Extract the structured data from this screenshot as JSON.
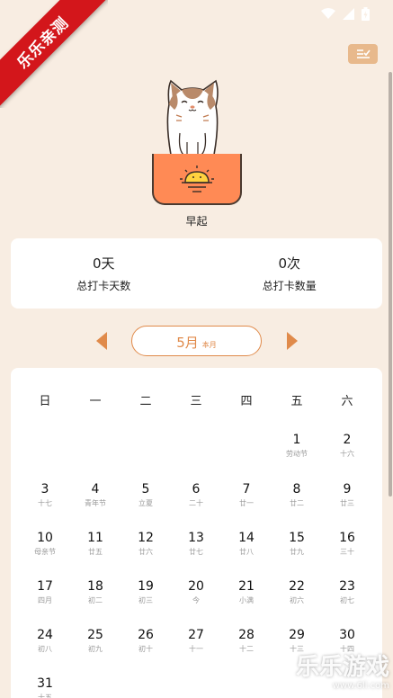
{
  "banner": {
    "text": "乐乐亲测"
  },
  "habit": {
    "name": "早起"
  },
  "stats": [
    {
      "value": "0天",
      "label": "总打卡天数"
    },
    {
      "value": "0次",
      "label": "总打卡数量"
    }
  ],
  "month": {
    "label": "5月",
    "sub": "本月"
  },
  "weekdays": [
    "日",
    "一",
    "二",
    "三",
    "四",
    "五",
    "六"
  ],
  "days": [
    {
      "num": "1",
      "lunar": "劳动节"
    },
    {
      "num": "2",
      "lunar": "十六"
    },
    {
      "num": "3",
      "lunar": "十七"
    },
    {
      "num": "4",
      "lunar": "青年节"
    },
    {
      "num": "5",
      "lunar": "立夏"
    },
    {
      "num": "6",
      "lunar": "二十"
    },
    {
      "num": "7",
      "lunar": "廿一"
    },
    {
      "num": "8",
      "lunar": "廿二"
    },
    {
      "num": "9",
      "lunar": "廿三"
    },
    {
      "num": "10",
      "lunar": "母亲节"
    },
    {
      "num": "11",
      "lunar": "廿五"
    },
    {
      "num": "12",
      "lunar": "廿六"
    },
    {
      "num": "13",
      "lunar": "廿七"
    },
    {
      "num": "14",
      "lunar": "廿八"
    },
    {
      "num": "15",
      "lunar": "廿九"
    },
    {
      "num": "16",
      "lunar": "三十"
    },
    {
      "num": "17",
      "lunar": "四月"
    },
    {
      "num": "18",
      "lunar": "初二"
    },
    {
      "num": "19",
      "lunar": "初三"
    },
    {
      "num": "20",
      "lunar": "今"
    },
    {
      "num": "21",
      "lunar": "小满"
    },
    {
      "num": "22",
      "lunar": "初六"
    },
    {
      "num": "23",
      "lunar": "初七"
    },
    {
      "num": "24",
      "lunar": "初八"
    },
    {
      "num": "25",
      "lunar": "初九"
    },
    {
      "num": "26",
      "lunar": "初十"
    },
    {
      "num": "27",
      "lunar": "十一"
    },
    {
      "num": "28",
      "lunar": "十二"
    },
    {
      "num": "29",
      "lunar": "十三"
    },
    {
      "num": "30",
      "lunar": "十四"
    },
    {
      "num": "31",
      "lunar": "十五"
    }
  ],
  "watermark": {
    "text": "乐乐游戏",
    "url": "www.6ll.com"
  },
  "colors": {
    "background": "#f8ede2",
    "accent": "#e08a4a",
    "pocket": "#ff8a55",
    "banner": "#d3161b"
  },
  "icons": [
    "wifi-icon",
    "signal-icon",
    "battery-icon",
    "checklist-icon",
    "sunrise-icon",
    "chevron-left-icon",
    "chevron-right-icon"
  ]
}
